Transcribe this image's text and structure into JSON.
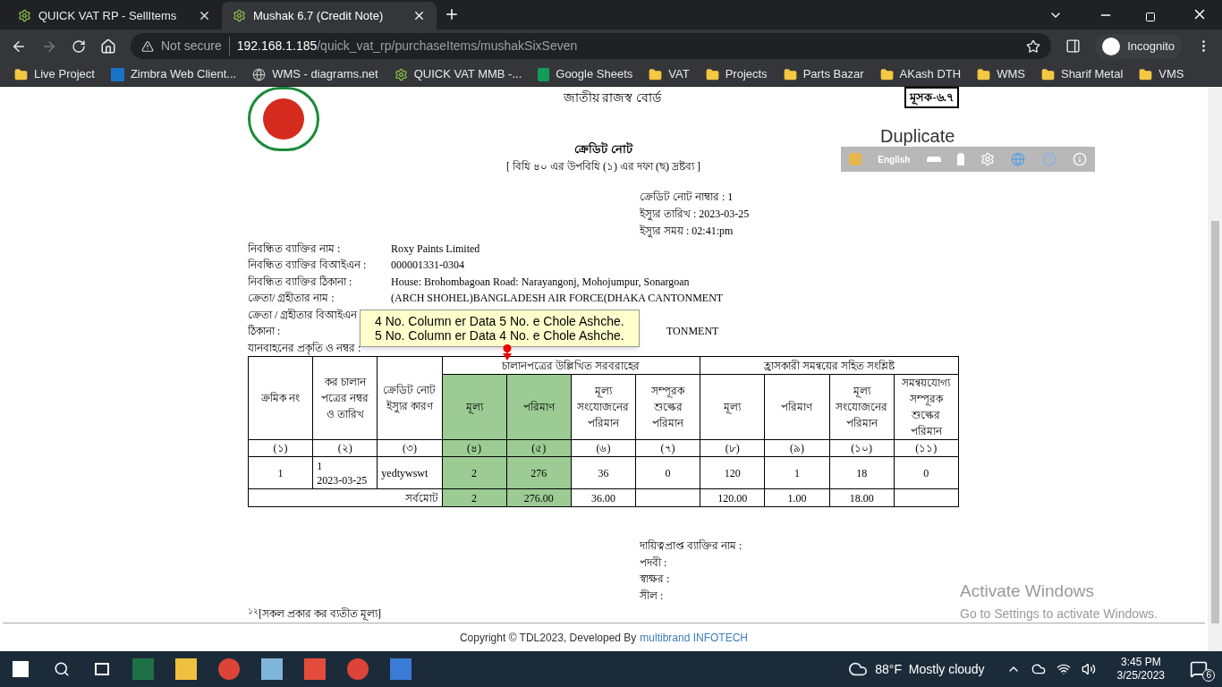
{
  "tabs": [
    {
      "label": "QUICK VAT RP - SellItems",
      "selected": false
    },
    {
      "label": "Mushak 6.7 (Credit Note)",
      "selected": true
    }
  ],
  "address": {
    "security": "Not secure",
    "host": "192.168.1.185",
    "path": "/quick_vat_rp/purchaseItems/mushakSixSeven"
  },
  "profile": "Incognito",
  "bookmarks": [
    {
      "label": "Live Project",
      "kind": "folder"
    },
    {
      "label": "Zimbra Web Client...",
      "kind": "zimbra"
    },
    {
      "label": "WMS - diagrams.net",
      "kind": "globe"
    },
    {
      "label": "QUICK VAT MMB -...",
      "kind": "gear"
    },
    {
      "label": "Google Sheets",
      "kind": "sheets"
    },
    {
      "label": "VAT",
      "kind": "folder"
    },
    {
      "label": "Projects",
      "kind": "folder"
    },
    {
      "label": "Parts Bazar",
      "kind": "folder"
    },
    {
      "label": "AKash DTH",
      "kind": "folder"
    },
    {
      "label": "WMS",
      "kind": "folder"
    },
    {
      "label": "Sharif Metal",
      "kind": "folder"
    },
    {
      "label": "VMS",
      "kind": "folder"
    }
  ],
  "document": {
    "authority": "জাতীয় রাজস্ব বোর্ড",
    "form_code": "মূসক-৬.৭",
    "title": "ক্রেডিট নোট",
    "subtitle": "[ বিধি ৪০ এর উপবিধি  (১) এর দফা (ছ) দ্রষ্টব্য ]",
    "meta": [
      "ক্রেডিট নোট নাম্বার : 1",
      "ইস্যুর তারিখ : 2023-03-25",
      "ইস্যুর সময় : 02:41:pm"
    ],
    "fields": [
      {
        "label": "নিবন্ধিত ব্যাক্তির নাম :",
        "value": "Roxy Paints Limited"
      },
      {
        "label": "নিবন্ধিত ব্যাক্তির বিআইএন :",
        "value": "000001331-0304"
      },
      {
        "label": "নিবন্ধিত ব্যাক্তির ঠিকানা :",
        "value": "House: Brohombagoan Road: Narayangonj, Mohojumpur, Sonargoan"
      },
      {
        "label": "ক্রেতা/ গ্রহীতার নাম :",
        "value": "(ARCH SHOHEL)BANGLADESH AIR FORCE(DHAKA CANTONMENT"
      },
      {
        "label": "ক্রেতা / গ্রহীতার বিআইএন"
      },
      {
        "label": "ঠিকানা :",
        "value": "TONMENT"
      },
      {
        "label": "যানবাহনের প্রকৃতি ও নম্বর :"
      }
    ],
    "table": {
      "fixed_columns": [
        "ক্রমিক নং",
        "কর চালান পত্রের নম্বর ও তারিখ",
        "ক্রেডিট নোট ইস্যুর কারণ"
      ],
      "groups": [
        {
          "title": "চালানপত্রের উল্লিখিত সরবরাহের",
          "columns": [
            {
              "label": "মূল্য",
              "highlighted": true
            },
            {
              "label": "পরিমাণ",
              "highlighted": true
            },
            {
              "label": "মূল্য সংযোজনের পরিমান",
              "highlighted": false
            },
            {
              "label": "সম্পূরক শুল্কের পরিমান",
              "highlighted": false
            }
          ]
        },
        {
          "title": "হ্রাসকারী সমন্বয়ের সহিত সংশ্লিষ্ট",
          "columns": [
            {
              "label": "মূল্য",
              "highlighted": false
            },
            {
              "label": "পরিমাণ",
              "highlighted": false
            },
            {
              "label": "মূল্য সংযোজনের পরিমান",
              "highlighted": false
            },
            {
              "label": "সমন্বয়যোগ্য সম্পূরক শুল্কের পরিমান",
              "highlighted": false
            }
          ]
        }
      ],
      "numbers": [
        "(১)",
        "(২)",
        "(৩)",
        "(৪)",
        "(৫)",
        "(৬)",
        "(৭)",
        "(৮)",
        "(৯)",
        "(১০)",
        "(১১)"
      ],
      "rows": [
        {
          "serial": "1",
          "invoice_no": "1",
          "invoice_date": "2023-03-25",
          "reason": "yedtywswt",
          "values": [
            "2",
            "276",
            "36",
            "0",
            "120",
            "1",
            "18",
            "0"
          ]
        }
      ],
      "total_label": "সর্বমোট",
      "totals": [
        {
          "kind": "amount",
          "value": "2"
        },
        {
          "kind": "amount",
          "value": "276.00"
        },
        {
          "kind": "amount",
          "value": "36.00"
        },
        {
          "kind": "blank"
        },
        {
          "kind": "amount",
          "value": "120.00"
        },
        {
          "kind": "amount",
          "value": "1.00"
        },
        {
          "kind": "amount",
          "value": "18.00"
        },
        {
          "kind": "blank"
        }
      ]
    },
    "signature": [
      "দায়িত্বপ্রাপ্ত ব্যাক্তির নাম :",
      "পদবী :",
      "স্বাক্ষর :",
      "সীল :"
    ],
    "footnote_mark": "১২",
    "footnote": "[সকল প্রকার কর ব্যতীত মূল্য]"
  },
  "annotation": {
    "lines": [
      "4 No. Column er Data 5 No. e Chole Ashche.",
      "5 No. Column er Data 4 No. e Chole Ashche."
    ]
  },
  "overlay_toolbar": {
    "label": "Duplicate",
    "language": "English"
  },
  "footer": {
    "text": "Copyright © TDL2023, Developed By",
    "link": "multibrand INFOTECH"
  },
  "windows_watermark": [
    "Activate Windows",
    "Go to Settings to activate Windows."
  ],
  "taskbar": {
    "weather": "88°F  Mostly cloudy",
    "time": "3:45 PM",
    "date": "3/25/2023",
    "notifications": "6"
  }
}
